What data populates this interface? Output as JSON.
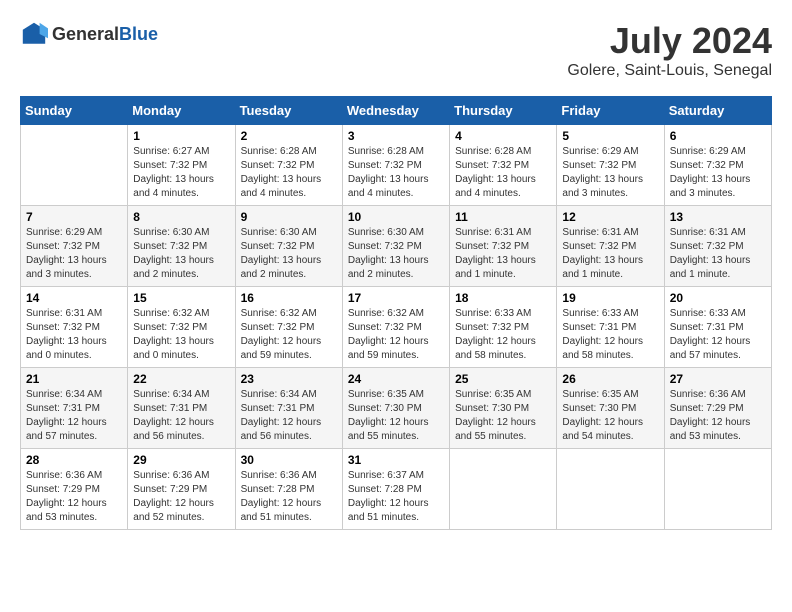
{
  "header": {
    "logo_general": "General",
    "logo_blue": "Blue",
    "month_year": "July 2024",
    "location": "Golere, Saint-Louis, Senegal"
  },
  "days_of_week": [
    "Sunday",
    "Monday",
    "Tuesday",
    "Wednesday",
    "Thursday",
    "Friday",
    "Saturday"
  ],
  "weeks": [
    [
      {
        "day": "",
        "sunrise": "",
        "sunset": "",
        "daylight": ""
      },
      {
        "day": "1",
        "sunrise": "Sunrise: 6:27 AM",
        "sunset": "Sunset: 7:32 PM",
        "daylight": "Daylight: 13 hours and 4 minutes."
      },
      {
        "day": "2",
        "sunrise": "Sunrise: 6:28 AM",
        "sunset": "Sunset: 7:32 PM",
        "daylight": "Daylight: 13 hours and 4 minutes."
      },
      {
        "day": "3",
        "sunrise": "Sunrise: 6:28 AM",
        "sunset": "Sunset: 7:32 PM",
        "daylight": "Daylight: 13 hours and 4 minutes."
      },
      {
        "day": "4",
        "sunrise": "Sunrise: 6:28 AM",
        "sunset": "Sunset: 7:32 PM",
        "daylight": "Daylight: 13 hours and 4 minutes."
      },
      {
        "day": "5",
        "sunrise": "Sunrise: 6:29 AM",
        "sunset": "Sunset: 7:32 PM",
        "daylight": "Daylight: 13 hours and 3 minutes."
      },
      {
        "day": "6",
        "sunrise": "Sunrise: 6:29 AM",
        "sunset": "Sunset: 7:32 PM",
        "daylight": "Daylight: 13 hours and 3 minutes."
      }
    ],
    [
      {
        "day": "7",
        "sunrise": "Sunrise: 6:29 AM",
        "sunset": "Sunset: 7:32 PM",
        "daylight": "Daylight: 13 hours and 3 minutes."
      },
      {
        "day": "8",
        "sunrise": "Sunrise: 6:30 AM",
        "sunset": "Sunset: 7:32 PM",
        "daylight": "Daylight: 13 hours and 2 minutes."
      },
      {
        "day": "9",
        "sunrise": "Sunrise: 6:30 AM",
        "sunset": "Sunset: 7:32 PM",
        "daylight": "Daylight: 13 hours and 2 minutes."
      },
      {
        "day": "10",
        "sunrise": "Sunrise: 6:30 AM",
        "sunset": "Sunset: 7:32 PM",
        "daylight": "Daylight: 13 hours and 2 minutes."
      },
      {
        "day": "11",
        "sunrise": "Sunrise: 6:31 AM",
        "sunset": "Sunset: 7:32 PM",
        "daylight": "Daylight: 13 hours and 1 minute."
      },
      {
        "day": "12",
        "sunrise": "Sunrise: 6:31 AM",
        "sunset": "Sunset: 7:32 PM",
        "daylight": "Daylight: 13 hours and 1 minute."
      },
      {
        "day": "13",
        "sunrise": "Sunrise: 6:31 AM",
        "sunset": "Sunset: 7:32 PM",
        "daylight": "Daylight: 13 hours and 1 minute."
      }
    ],
    [
      {
        "day": "14",
        "sunrise": "Sunrise: 6:31 AM",
        "sunset": "Sunset: 7:32 PM",
        "daylight": "Daylight: 13 hours and 0 minutes."
      },
      {
        "day": "15",
        "sunrise": "Sunrise: 6:32 AM",
        "sunset": "Sunset: 7:32 PM",
        "daylight": "Daylight: 13 hours and 0 minutes."
      },
      {
        "day": "16",
        "sunrise": "Sunrise: 6:32 AM",
        "sunset": "Sunset: 7:32 PM",
        "daylight": "Daylight: 12 hours and 59 minutes."
      },
      {
        "day": "17",
        "sunrise": "Sunrise: 6:32 AM",
        "sunset": "Sunset: 7:32 PM",
        "daylight": "Daylight: 12 hours and 59 minutes."
      },
      {
        "day": "18",
        "sunrise": "Sunrise: 6:33 AM",
        "sunset": "Sunset: 7:32 PM",
        "daylight": "Daylight: 12 hours and 58 minutes."
      },
      {
        "day": "19",
        "sunrise": "Sunrise: 6:33 AM",
        "sunset": "Sunset: 7:31 PM",
        "daylight": "Daylight: 12 hours and 58 minutes."
      },
      {
        "day": "20",
        "sunrise": "Sunrise: 6:33 AM",
        "sunset": "Sunset: 7:31 PM",
        "daylight": "Daylight: 12 hours and 57 minutes."
      }
    ],
    [
      {
        "day": "21",
        "sunrise": "Sunrise: 6:34 AM",
        "sunset": "Sunset: 7:31 PM",
        "daylight": "Daylight: 12 hours and 57 minutes."
      },
      {
        "day": "22",
        "sunrise": "Sunrise: 6:34 AM",
        "sunset": "Sunset: 7:31 PM",
        "daylight": "Daylight: 12 hours and 56 minutes."
      },
      {
        "day": "23",
        "sunrise": "Sunrise: 6:34 AM",
        "sunset": "Sunset: 7:31 PM",
        "daylight": "Daylight: 12 hours and 56 minutes."
      },
      {
        "day": "24",
        "sunrise": "Sunrise: 6:35 AM",
        "sunset": "Sunset: 7:30 PM",
        "daylight": "Daylight: 12 hours and 55 minutes."
      },
      {
        "day": "25",
        "sunrise": "Sunrise: 6:35 AM",
        "sunset": "Sunset: 7:30 PM",
        "daylight": "Daylight: 12 hours and 55 minutes."
      },
      {
        "day": "26",
        "sunrise": "Sunrise: 6:35 AM",
        "sunset": "Sunset: 7:30 PM",
        "daylight": "Daylight: 12 hours and 54 minutes."
      },
      {
        "day": "27",
        "sunrise": "Sunrise: 6:36 AM",
        "sunset": "Sunset: 7:29 PM",
        "daylight": "Daylight: 12 hours and 53 minutes."
      }
    ],
    [
      {
        "day": "28",
        "sunrise": "Sunrise: 6:36 AM",
        "sunset": "Sunset: 7:29 PM",
        "daylight": "Daylight: 12 hours and 53 minutes."
      },
      {
        "day": "29",
        "sunrise": "Sunrise: 6:36 AM",
        "sunset": "Sunset: 7:29 PM",
        "daylight": "Daylight: 12 hours and 52 minutes."
      },
      {
        "day": "30",
        "sunrise": "Sunrise: 6:36 AM",
        "sunset": "Sunset: 7:28 PM",
        "daylight": "Daylight: 12 hours and 51 minutes."
      },
      {
        "day": "31",
        "sunrise": "Sunrise: 6:37 AM",
        "sunset": "Sunset: 7:28 PM",
        "daylight": "Daylight: 12 hours and 51 minutes."
      },
      {
        "day": "",
        "sunrise": "",
        "sunset": "",
        "daylight": ""
      },
      {
        "day": "",
        "sunrise": "",
        "sunset": "",
        "daylight": ""
      },
      {
        "day": "",
        "sunrise": "",
        "sunset": "",
        "daylight": ""
      }
    ]
  ]
}
